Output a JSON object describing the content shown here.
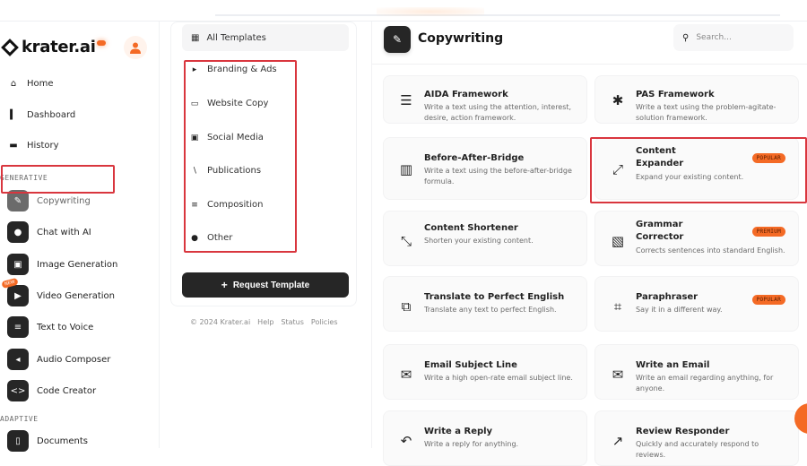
{
  "brand": {
    "name": "krater.ai",
    "accent": "#f46a25",
    "highlight": "#d9363e"
  },
  "sidebar": {
    "nav": [
      {
        "label": "Home",
        "icon": "home-icon"
      },
      {
        "label": "Dashboard",
        "icon": "bar-chart-icon"
      },
      {
        "label": "History",
        "icon": "folder-icon"
      }
    ],
    "generative_label": "GENERATIVE",
    "generative": [
      {
        "label": "Copywriting",
        "icon": "pencil-icon",
        "active": true
      },
      {
        "label": "Chat with AI",
        "icon": "chat-icon"
      },
      {
        "label": "Image Generation",
        "icon": "image-icon"
      },
      {
        "label": "Video Generation",
        "icon": "video-icon",
        "badge": "NEW"
      },
      {
        "label": "Text to Voice",
        "icon": "microphone-icon"
      },
      {
        "label": "Audio Composer",
        "icon": "speaker-icon"
      },
      {
        "label": "Code Creator",
        "icon": "code-icon"
      }
    ],
    "adaptive_label": "ADAPTIVE",
    "adaptive": [
      {
        "label": "Documents",
        "icon": "document-icon"
      }
    ]
  },
  "templates": {
    "all_label": "All Templates",
    "categories": [
      {
        "label": "Branding & Ads",
        "icon": "megaphone-icon"
      },
      {
        "label": "Website Copy",
        "icon": "laptop-icon"
      },
      {
        "label": "Social Media",
        "icon": "facebook-icon"
      },
      {
        "label": "Publications",
        "icon": "paperclip-icon"
      },
      {
        "label": "Composition",
        "icon": "align-left-icon"
      },
      {
        "label": "Other",
        "icon": "globe-icon"
      }
    ],
    "request_button": "Request Template",
    "footer": [
      "© 2024 Krater.ai",
      "Help",
      "Status",
      "Policies"
    ]
  },
  "main": {
    "title": "Copywriting",
    "search_placeholder": "Search...",
    "cards": [
      {
        "title": "AIDA Framework",
        "desc": "Write a text using the attention, interest, desire, action framework.",
        "icon": "layers-icon"
      },
      {
        "title": "PAS Framework",
        "desc": "Write a text using the problem-agitate-solution framework.",
        "icon": "asterisk-icon"
      },
      {
        "title": "Before-After-Bridge",
        "desc": "Write a text using the before-after-bridge formula.",
        "icon": "map-icon"
      },
      {
        "title": "Content Expander",
        "desc": "Expand your existing content.",
        "icon": "expand-icon",
        "badge": "POPULAR"
      },
      {
        "title": "Content Shortener",
        "desc": "Shorten your existing content.",
        "icon": "compress-icon"
      },
      {
        "title": "Grammar Corrector",
        "desc": "Corrects sentences into standard English.",
        "icon": "copy-file-icon",
        "badge": "PREMIUM"
      },
      {
        "title": "Translate to Perfect English",
        "desc": "Translate any text to perfect English.",
        "icon": "clone-icon"
      },
      {
        "title": "Paraphraser",
        "desc": "Say it in a different way.",
        "icon": "crop-icon",
        "badge": "POPULAR"
      },
      {
        "title": "Email Subject Line",
        "desc": "Write a high open-rate email subject line.",
        "icon": "envelope-icon"
      },
      {
        "title": "Write an Email",
        "desc": "Write an email regarding anything, for anyone.",
        "icon": "envelope-open-icon"
      },
      {
        "title": "Write a Reply",
        "desc": "Write a reply for anything.",
        "icon": "reply-all-icon"
      },
      {
        "title": "Review Responder",
        "desc": "Quickly and accurately respond to reviews.",
        "icon": "share-square-icon"
      }
    ]
  }
}
